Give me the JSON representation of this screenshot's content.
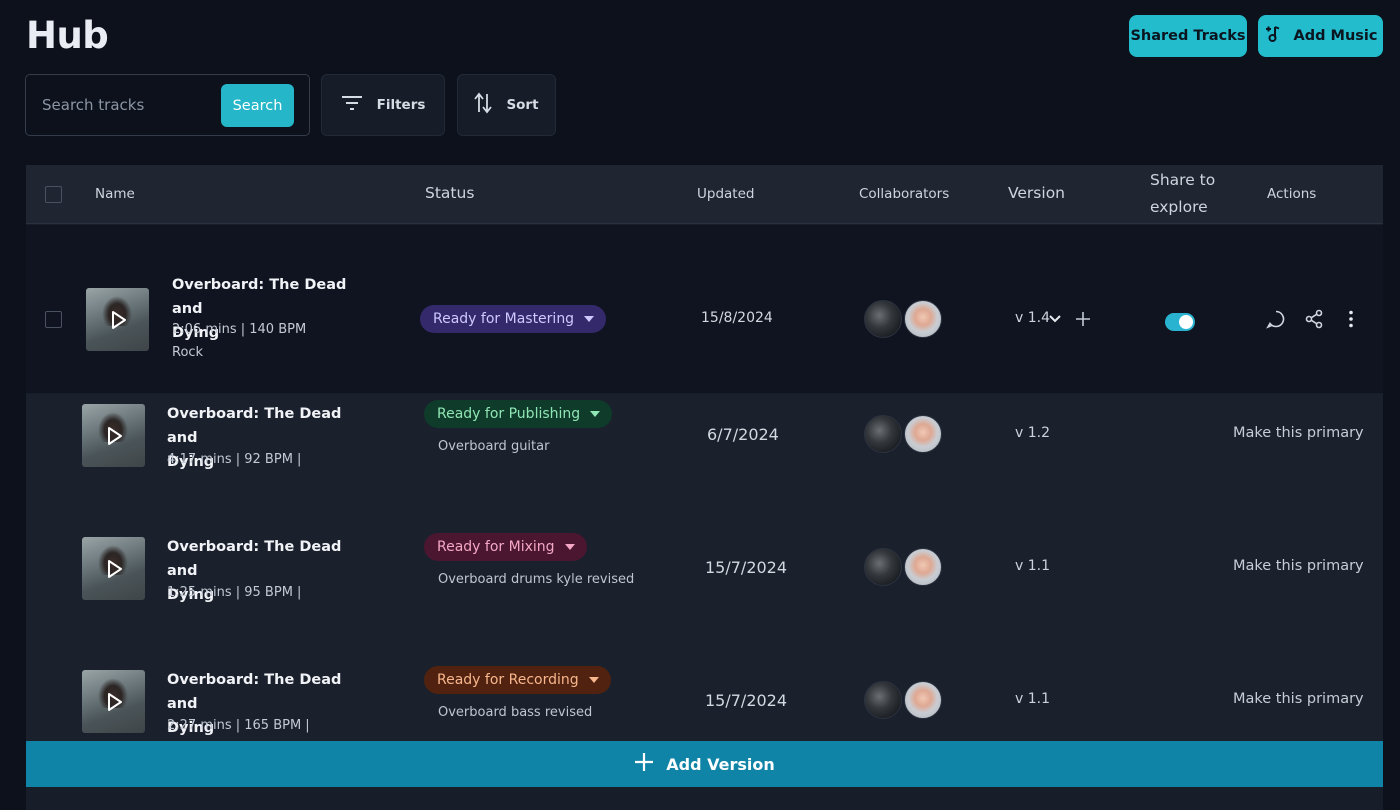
{
  "header": {
    "title": "Hub",
    "shared_tracks_label": "Shared Tracks",
    "add_music_label": "Add Music"
  },
  "toolbar": {
    "search_placeholder": "Search tracks",
    "search_value": "",
    "search_button": "Search",
    "filters_label": "Filters",
    "sort_label": "Sort"
  },
  "table": {
    "columns": {
      "name": "Name",
      "status": "Status",
      "updated": "Updated",
      "collaborators": "Collaborators",
      "version": "Version",
      "share_line1": "Share to",
      "share_line2": "explore",
      "actions": "Actions"
    },
    "primary": {
      "title_line1": "Overboard: The Dead and",
      "title_line2": "Dying",
      "duration_bpm": "2:06 mins | 140 BPM",
      "genre": "Rock",
      "status": "Ready for Mastering",
      "updated": "15/8/2024",
      "version": "v 1.4",
      "share_enabled": true
    },
    "versions": [
      {
        "title_line1": "Overboard: The Dead and",
        "title_line2": "Dying",
        "duration_bpm": "4:17 mins | 92 BPM |",
        "status": "Ready for Publishing",
        "note": "Overboard guitar",
        "updated": "6/7/2024",
        "version": "v 1.2",
        "action": "Make this primary"
      },
      {
        "title_line1": "Overboard: The Dead and",
        "title_line2": "Dying",
        "duration_bpm": "1:25 mins | 95 BPM |",
        "status": "Ready for Mixing",
        "note": "Overboard drums kyle revised",
        "updated": "15/7/2024",
        "version": "v 1.1",
        "action": "Make this primary"
      },
      {
        "title_line1": "Overboard: The Dead and",
        "title_line2": "Dying",
        "duration_bpm": "2:27 mins | 165 BPM |",
        "status": "Ready for Recording",
        "note": "Overboard bass revised",
        "updated": "15/7/2024",
        "version": "v 1.1",
        "action": "Make this primary"
      }
    ],
    "add_version_label": "Add Version"
  },
  "colors": {
    "background": "#0c111c",
    "accent": "#22bccd",
    "add_version_bar": "#1084a7",
    "mastering": "#342a6b",
    "publishing": "#0f3b2a",
    "mixing": "#4a1630",
    "recording": "#50220f"
  },
  "icons": [
    "music-note-plus-icon",
    "filter-lines-icon",
    "sort-arrows-icon",
    "play-icon",
    "chevron-down-icon",
    "plus-icon",
    "comment-icon",
    "share-icon",
    "more-vertical-icon"
  ]
}
